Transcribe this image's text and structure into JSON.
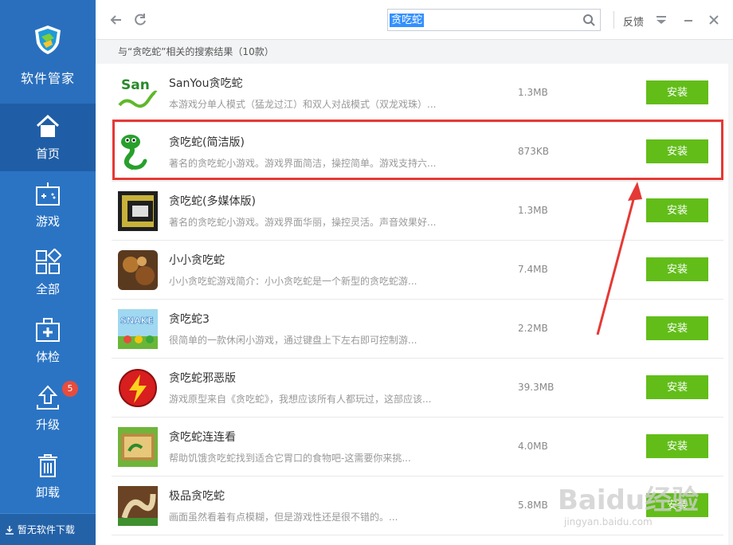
{
  "sidebar": {
    "app_name": "软件管家",
    "items": [
      {
        "label": "首页",
        "icon": "home-icon",
        "active": true
      },
      {
        "label": "游戏",
        "icon": "gamepad-icon",
        "active": false
      },
      {
        "label": "全部",
        "icon": "grid-icon",
        "active": false
      },
      {
        "label": "体检",
        "icon": "medical-kit-icon",
        "active": false
      },
      {
        "label": "升级",
        "icon": "upload-arrow-icon",
        "active": false,
        "badge": "5"
      },
      {
        "label": "卸载",
        "icon": "trash-icon",
        "active": false
      }
    ],
    "download_status": "暂无软件下载"
  },
  "toolbar": {
    "search_value": "贪吃蛇",
    "feedback_label": "反馈"
  },
  "results_header": "与“贪吃蛇”相关的搜索结果（10款）",
  "results": [
    {
      "title": "SanYou贪吃蛇",
      "desc": "本游戏分单人模式（猛龙过江）和双人对战模式（双龙戏珠）...",
      "size": "1.3MB",
      "install": "安装",
      "thumb": "sanyou-snake"
    },
    {
      "title": "贪吃蛇(简洁版)",
      "desc": "著名的贪吃蛇小游戏。游戏界面简洁，操控简单。游戏支持六...",
      "size": "873KB",
      "install": "安装",
      "thumb": "green-snake"
    },
    {
      "title": "贪吃蛇(多媒体版)",
      "desc": "著名的贪吃蛇小游戏。游戏界面华丽，操控灵活。声音效果好...",
      "size": "1.3MB",
      "install": "安装",
      "thumb": "maze-snake"
    },
    {
      "title": "小小贪吃蛇",
      "desc": "小小贪吃蛇游戏简介：小小贪吃蛇是一个新型的贪吃蛇游...",
      "size": "7.4MB",
      "install": "安装",
      "thumb": "brown-snake"
    },
    {
      "title": "贪吃蛇3",
      "desc": "很简单的一款休闲小游戏，通过键盘上下左右即可控制游...",
      "size": "2.2MB",
      "install": "安装",
      "thumb": "snake3"
    },
    {
      "title": "贪吃蛇邪恶版",
      "desc": "游戏原型来自《贪吃蛇》，我想应该所有人都玩过，这部应该...",
      "size": "39.3MB",
      "install": "安装",
      "thumb": "lightning"
    },
    {
      "title": "贪吃蛇连连看",
      "desc": "帮助饥饿贪吃蛇找到适合它胃口的食物吧-这需要你来挑...",
      "size": "4.0MB",
      "install": "安装",
      "thumb": "matchup"
    },
    {
      "title": "极品贪吃蛇",
      "desc": "画面虽然看着有点模糊，但是游戏性还是很不错的。...",
      "size": "5.8MB",
      "install": "安装",
      "thumb": "best-snake"
    }
  ],
  "watermark": {
    "main": "Baidu经验",
    "sub": "jingyan.baidu.com"
  },
  "colors": {
    "sidebar": "#2b74c4",
    "install_button": "#62bd19",
    "highlight": "#e53935"
  }
}
